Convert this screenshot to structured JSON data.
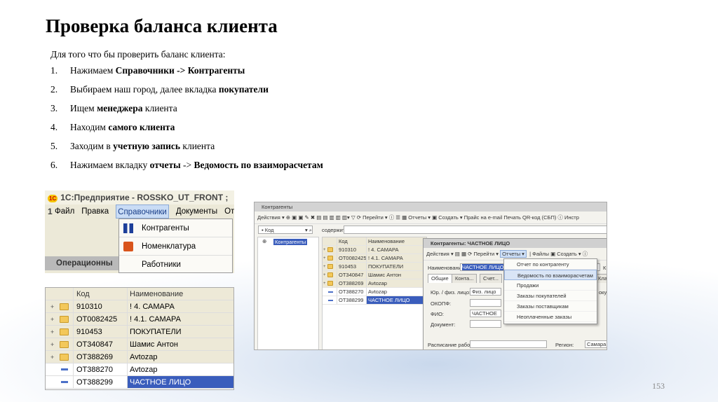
{
  "title": "Проверка баланса клиента",
  "intro": "Для того что бы проверить баланс клиента:",
  "steps": [
    {
      "n": "1.",
      "pre": "Нажимаем ",
      "b1": "Справочники -> Контрагенты",
      "mid": "",
      "b2": "",
      "post": ""
    },
    {
      "n": "2.",
      "pre": "Выбираем наш город, далее вкладка ",
      "b1": "покупатели",
      "mid": "",
      "b2": "",
      "post": ""
    },
    {
      "n": "3.",
      "pre": "Ищем ",
      "b1": "менеджера",
      "mid": " клиента",
      "b2": "",
      "post": ""
    },
    {
      "n": "4.",
      "pre": "Находим ",
      "b1": "самого клиента",
      "mid": "",
      "b2": "",
      "post": ""
    },
    {
      "n": "5.",
      "pre": "Заходим в ",
      "b1": "учетную запись",
      "mid": " клиента",
      "b2": "",
      "post": ""
    },
    {
      "n": "6.",
      "pre": "Нажимаем вкладку ",
      "b1": "отчеты",
      "mid": " -> ",
      "b2": "Ведомость по взаиморасчетам",
      "post": ""
    }
  ],
  "page_number": "153",
  "shot1": {
    "window_title": "1С:Предприятие - ROSSKO_UT_FRONT ; 1",
    "logo": "1С",
    "menu": [
      "Файл",
      "Правка",
      "Справочники",
      "Документы",
      "Отч"
    ],
    "dropdown": [
      "Контрагенты",
      "Номенклатура",
      "Работники"
    ],
    "panel": "Операционны"
  },
  "table": {
    "headers": [
      "Код",
      "Наименование"
    ],
    "rows": [
      {
        "code": "910310",
        "name": "! 4. САМАРА",
        "type": "group"
      },
      {
        "code": "ОТ0082425",
        "name": "! 4.1. САМАРА",
        "type": "group"
      },
      {
        "code": "910453",
        "name": "ПОКУПАТЕЛИ",
        "type": "group"
      },
      {
        "code": "ОТ340847",
        "name": "Шамис Антон",
        "type": "group"
      },
      {
        "code": "ОТ388269",
        "name": "Avtozap",
        "type": "group"
      },
      {
        "code": "ОТ388270",
        "name": "Avtozap",
        "type": "item"
      },
      {
        "code": "ОТ388299",
        "name": "ЧАСТНОЕ ЛИЦО",
        "type": "item-selected"
      }
    ]
  },
  "shot3": {
    "window_title": "Контрагенты",
    "toolbar": "Действия ▾  ⊕ ▣ ▣ ✎ ✖  ▤ ▤  ▥ ▥ ▥▾ ▽  ⟳ Перейти ▾  ⓘ  ☰ ▦  Отчеты ▾  ▣  Создать ▾  Прайс на e-mail  Печать QR-код (СБП)  ⓘ Инстр",
    "filter_field": "Код",
    "filter_label": "содержит:",
    "tree_node": "Контрагенты",
    "form_title": "Контрагенты: ЧАСТНОЕ ЛИЦО",
    "form_toolbar_left": "Действия ▾  ▤  ▦  ⟳ Перейти ▾",
    "form_reports": "Отчеты ▾",
    "form_toolbar_right": "Файлы  ▣  Создать ▾  ⓘ",
    "name_label": "Наименование:",
    "name_value": "ЧАСТНОЕ ЛИЦО",
    "tabs": [
      "Общие",
      "Конта...",
      "Счет..."
    ],
    "tab_right": "Клас",
    "fields": {
      "type_label": "Юр. / физ. лицо:",
      "type_value": "Физ. лицо",
      "okopf_label": "ОКОПФ:",
      "fio_label": "ФИО:",
      "fio_value": "ЧАСТНОЕ ЛИЦ",
      "doc_label": "Документ:",
      "schedule_label": "Расписание работы:",
      "region_label": "Регион:",
      "region_value": "Самара",
      "right_k": "К",
      "right_pok": "окуп"
    },
    "reports_menu": [
      "Отчет по контрагенту",
      "Ведомость по взаиморасчетам",
      "Продажи",
      "Заказы покупателей",
      "Заказы поставщикам",
      "Неоплаченные заказы"
    ]
  }
}
